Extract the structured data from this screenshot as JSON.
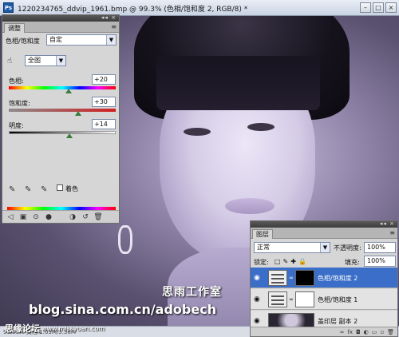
{
  "document": {
    "title": "1220234765_ddvip_1961.bmp @ 99.3% (色相/饱和度 2, RGB/8) *",
    "app_icon": "Ps",
    "window_buttons": [
      "–",
      "□",
      "×"
    ],
    "zoom_status": "99.33%  文档:1.03M/3.38M"
  },
  "watermarks": {
    "studio": "思雨工作室",
    "blog": "blog.sina.com.cn/adobech",
    "forum": "思缘论坛",
    "site": "www.missyuan.com"
  },
  "adjustments_panel": {
    "tab": "调整",
    "preset_label": "色相/饱和度",
    "preset_value": "自定",
    "edit_value": "全图",
    "hue": {
      "label": "色相:",
      "value": "+20",
      "level": 0.556
    },
    "saturation": {
      "label": "饱和度:",
      "value": "+30",
      "level": 0.65
    },
    "lightness": {
      "label": "明度:",
      "value": "+14",
      "level": 0.57
    },
    "colorize_label": "着色"
  },
  "layers_panel": {
    "tab": "图层",
    "blend_mode": "正常",
    "opacity_label": "不透明度:",
    "opacity_value": "100%",
    "lock_label": "锁定:",
    "fill_label": "填充:",
    "fill_value": "100%",
    "layers": [
      {
        "name": "色相/饱和度 2",
        "selected": true,
        "mask": "black"
      },
      {
        "name": "色相/饱和度 1",
        "selected": false,
        "mask": "white"
      },
      {
        "name": "盖印层 副本 2",
        "selected": false,
        "mask": "photo"
      }
    ]
  },
  "icons": {
    "eyedropper": "✎",
    "visibility": "👁",
    "menu": "≡"
  }
}
